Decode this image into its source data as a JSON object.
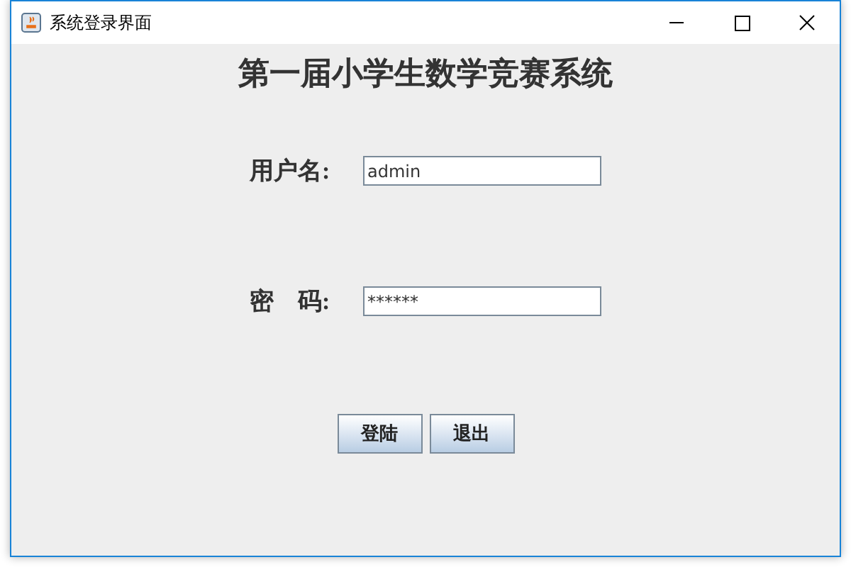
{
  "window": {
    "title": "系统登录界面"
  },
  "heading": "第一届小学生数学竞赛系统",
  "fields": [
    {
      "label": "用户名:",
      "value": "admin"
    },
    {
      "label": "密　码:",
      "value": "******"
    }
  ],
  "buttons": [
    "登陆",
    "退出"
  ]
}
